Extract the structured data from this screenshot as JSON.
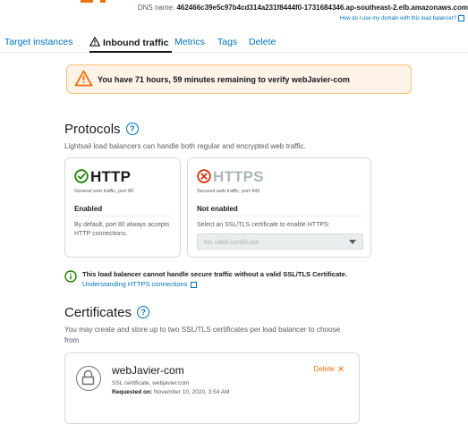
{
  "header": {
    "dns_label": "DNS name:",
    "dns_value": "462466c39e5c97b4cd314a231f8444f0-1731684346.ap-southeast-2.elb.amazonaws.com",
    "dns_help_link": "How do I use my domain with this load balancer?"
  },
  "tabs": [
    {
      "label": "Target instances",
      "active": false
    },
    {
      "label": "Inbound traffic",
      "active": true
    },
    {
      "label": "Metrics",
      "active": false
    },
    {
      "label": "Tags",
      "active": false
    },
    {
      "label": "Delete",
      "active": false
    }
  ],
  "banner": {
    "text": "You have 71 hours, 59 minutes remaining to verify webJavier-com"
  },
  "protocols": {
    "heading": "Protocols",
    "help_icon": "?",
    "description": "Lightsail load balancers can handle both regular and encrypted web traffic.",
    "http": {
      "title": "HTTP",
      "subtitle": "General web traffic, port 80",
      "state": "Enabled",
      "note": "By default, port 80 always accepts HTTP connections."
    },
    "https": {
      "title": "HTTPS",
      "subtitle": "Secured web traffic, port 443",
      "state": "Not enabled",
      "note": "Select an SSL/TLS certificate to enable HTTPS:",
      "select_value": "No valid certificate"
    }
  },
  "notice": {
    "text": "This load balancer cannot handle secure traffic without a valid SSL/TLS Certificate.",
    "link": "Understanding HTTPS connections"
  },
  "certificates": {
    "heading": "Certificates",
    "help_icon": "?",
    "description": "You may create and store up to two SSL/TLS certificates per load balancer to choose from",
    "items": [
      {
        "name": "webJavier-com",
        "subtitle": "SSL certificate, webjavier.com",
        "requested_label": "Requested on:",
        "requested_value": "November 10, 2020, 3:54 AM",
        "delete_label": "Delete",
        "delete_icon": "✕"
      }
    ]
  },
  "colors": {
    "link": "#0073bb",
    "success": "#1d8102",
    "error": "#d13212",
    "warning": "#ec7211",
    "banner_bg": "#fdf3e6"
  }
}
